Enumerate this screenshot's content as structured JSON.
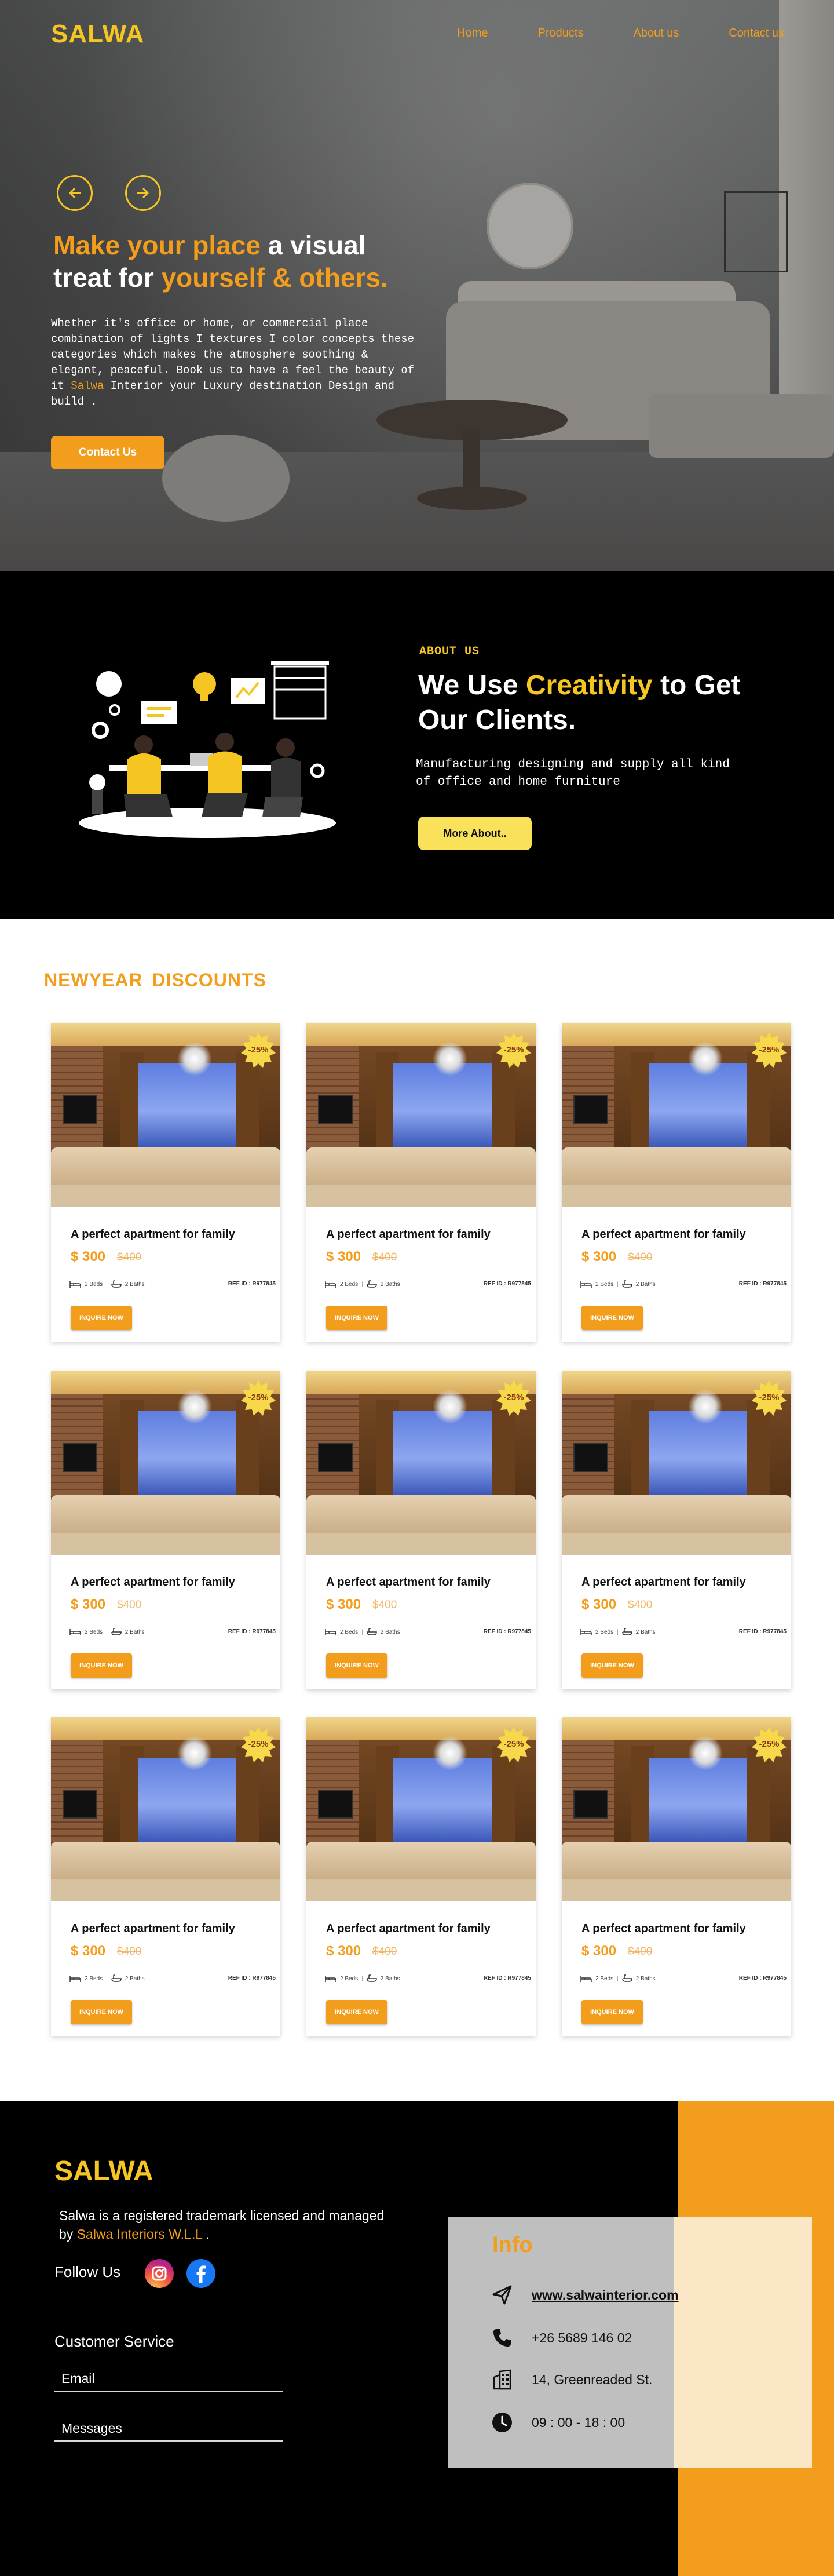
{
  "header": {
    "logo": "SALWA",
    "nav": [
      "Home",
      "Products",
      "About us",
      "Contact us"
    ]
  },
  "hero": {
    "title_part1": "Make your place",
    "title_part2": " a visual treat for ",
    "title_part3": "yourself & others.",
    "text_part1": "Whether it's office or home, or commercial place combination of lights I textures I color concepts these categories which makes the atmosphere soothing & elegant, peaceful. Book us to have a feel the beauty of it ",
    "text_brand": "Salwa",
    "text_part2": " Interior your Luxury destination Design and build .",
    "cta": "Contact Us"
  },
  "about": {
    "label": "ABOUT US",
    "title_part1": "We Use ",
    "title_part2": "Creativity",
    "title_part3": " to Get Our Clients.",
    "text": "Manufacturing designing and supply all kind of office and home furniture",
    "button": "More About.."
  },
  "discounts": {
    "title": "NEWYEAR  DISCOUNTS",
    "cards": [
      {
        "title": "A perfect apartment for family",
        "price": "$ 300",
        "old_price": "$400",
        "badge": "-25%",
        "beds": "2 Beds",
        "baths": "2 Baths",
        "ref": "REF ID : R977845",
        "button": "INQUIRE NOW"
      },
      {
        "title": "A perfect apartment for family",
        "price": "$ 300",
        "old_price": "$400",
        "badge": "-25%",
        "beds": "2 Beds",
        "baths": "2 Baths",
        "ref": "REF ID : R977845",
        "button": "INQUIRE NOW"
      },
      {
        "title": "A perfect apartment for family",
        "price": "$ 300",
        "old_price": "$400",
        "badge": "-25%",
        "beds": "2 Beds",
        "baths": "2 Baths",
        "ref": "REF ID : R977845",
        "button": "INQUIRE NOW"
      },
      {
        "title": "A perfect apartment for family",
        "price": "$ 300",
        "old_price": "$400",
        "badge": "-25%",
        "beds": "2 Beds",
        "baths": "2 Baths",
        "ref": "REF ID : R977845",
        "button": "INQUIRE NOW"
      },
      {
        "title": "A perfect apartment for family",
        "price": "$ 300",
        "old_price": "$400",
        "badge": "-25%",
        "beds": "2 Beds",
        "baths": "2 Baths",
        "ref": "REF ID : R977845",
        "button": "INQUIRE NOW"
      },
      {
        "title": "A perfect apartment for family",
        "price": "$ 300",
        "old_price": "$400",
        "badge": "-25%",
        "beds": "2 Beds",
        "baths": "2 Baths",
        "ref": "REF ID : R977845",
        "button": "INQUIRE NOW"
      },
      {
        "title": "A perfect apartment for family",
        "price": "$ 300",
        "old_price": "$400",
        "badge": "-25%",
        "beds": "2 Beds",
        "baths": "2 Baths",
        "ref": "REF ID : R977845",
        "button": "INQUIRE NOW"
      },
      {
        "title": "A perfect apartment for family",
        "price": "$ 300",
        "old_price": "$400",
        "badge": "-25%",
        "beds": "2 Beds",
        "baths": "2 Baths",
        "ref": "REF ID : R977845",
        "button": "INQUIRE NOW"
      },
      {
        "title": "A perfect apartment for family",
        "price": "$ 300",
        "old_price": "$400",
        "badge": "-25%",
        "beds": "2 Beds",
        "baths": "2 Baths",
        "ref": "REF ID : R977845",
        "button": "INQUIRE NOW"
      }
    ]
  },
  "footer": {
    "logo": "SALWA",
    "desc_part1": "Salwa is a registered trademark licensed and managed by ",
    "desc_brand": "Salwa Interiors W.L.L",
    "desc_part2": " .",
    "follow": "Follow Us",
    "social_icons": [
      "instagram-icon",
      "facebook-icon"
    ],
    "customer_service": "Customer Service",
    "email_placeholder": "Email",
    "messages_placeholder": "Messages",
    "info": {
      "title": "Info",
      "website": "www.salwainterior.com",
      "phone": "+26 5689 146 02",
      "address": "14, Greenreaded St.",
      "hours": "09 : 00  -  18 : 00"
    }
  },
  "colors": {
    "accent_orange": "#f29d1c",
    "accent_yellow": "#f5c521",
    "button_yellow": "#f9e15a",
    "dark": "#000000"
  }
}
